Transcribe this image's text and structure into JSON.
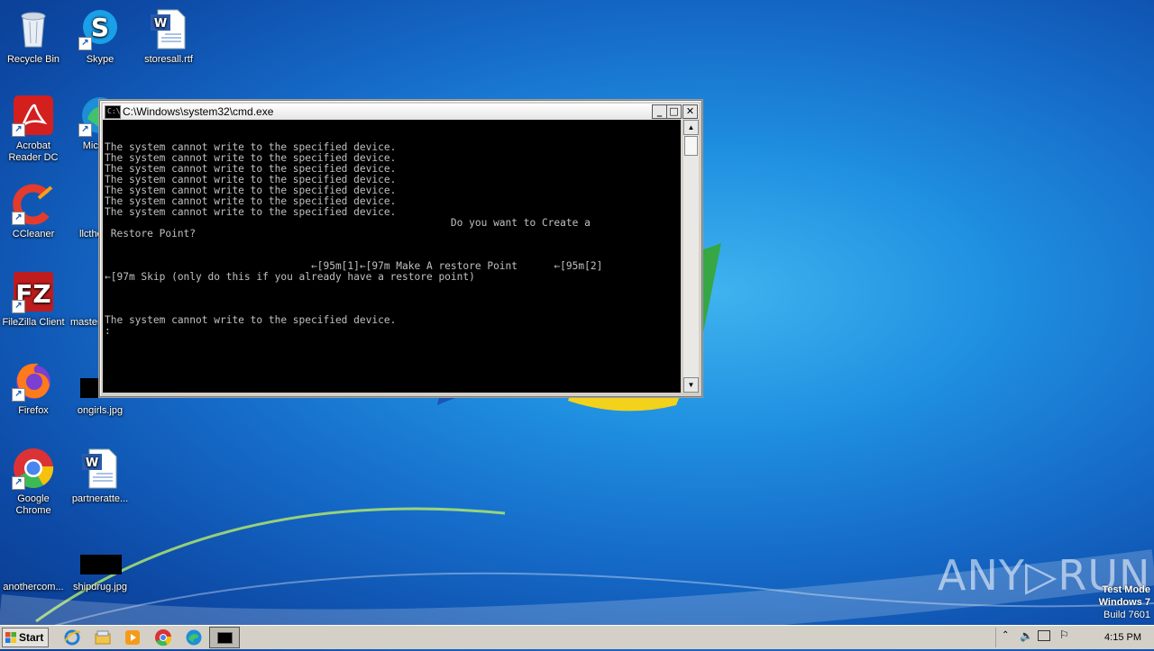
{
  "desktop": {
    "icons": [
      {
        "label": "Recycle Bin",
        "icon": "recycle-bin-icon"
      },
      {
        "label": "Skype",
        "icon": "skype-icon"
      },
      {
        "label": "storesall.rtf",
        "icon": "word-document-icon"
      },
      {
        "label": "Acrobat Reader DC",
        "icon": "acrobat-icon"
      },
      {
        "label": "Microso",
        "icon": "edge-icon"
      },
      {
        "label": "CCleaner",
        "icon": "ccleaner-icon"
      },
      {
        "label": "llcthe",
        "icon": "file-icon"
      },
      {
        "label": "FileZilla Client",
        "icon": "filezilla-icon"
      },
      {
        "label": "master",
        "icon": "file-icon"
      },
      {
        "label": "Firefox",
        "icon": "firefox-icon"
      },
      {
        "label": "ongirls.jpg",
        "icon": "image-thumbnail-icon"
      },
      {
        "label": "Google Chrome",
        "icon": "chrome-icon"
      },
      {
        "label": "partneratte...",
        "icon": "word-document-icon"
      },
      {
        "label": "anothercom...",
        "icon": "file-icon"
      },
      {
        "label": "shipdrug.jpg",
        "icon": "image-thumbnail-icon"
      }
    ]
  },
  "cmd": {
    "title": "C:\\Windows\\system32\\cmd.exe",
    "lines": "The system cannot write to the specified device.\nThe system cannot write to the specified device.\nThe system cannot write to the specified device.\nThe system cannot write to the specified device.\nThe system cannot write to the specified device.\nThe system cannot write to the specified device.\nThe system cannot write to the specified device.\n                                                         Do you want to Create a\n Restore Point?\n\n\n                                  ←[95m[1]←[97m Make A restore Point      ←[95m[2]\n←[97m Skip (only do this if you already have a restore point)\n\n\n\nThe system cannot write to the specified device.\n:"
  },
  "taskbar": {
    "start_label": "Start",
    "clock": "4:15 PM"
  },
  "watermark": {
    "line1": "Test Mode",
    "line2": "Windows 7",
    "line3": "Build 7601",
    "brand": "ANY▷RUN"
  },
  "colors": {
    "desktop_blue": "#1f8fe0",
    "cmd_background": "#000000",
    "cmd_text": "#c0c0c0",
    "taskbar": "#d4d0c8"
  }
}
